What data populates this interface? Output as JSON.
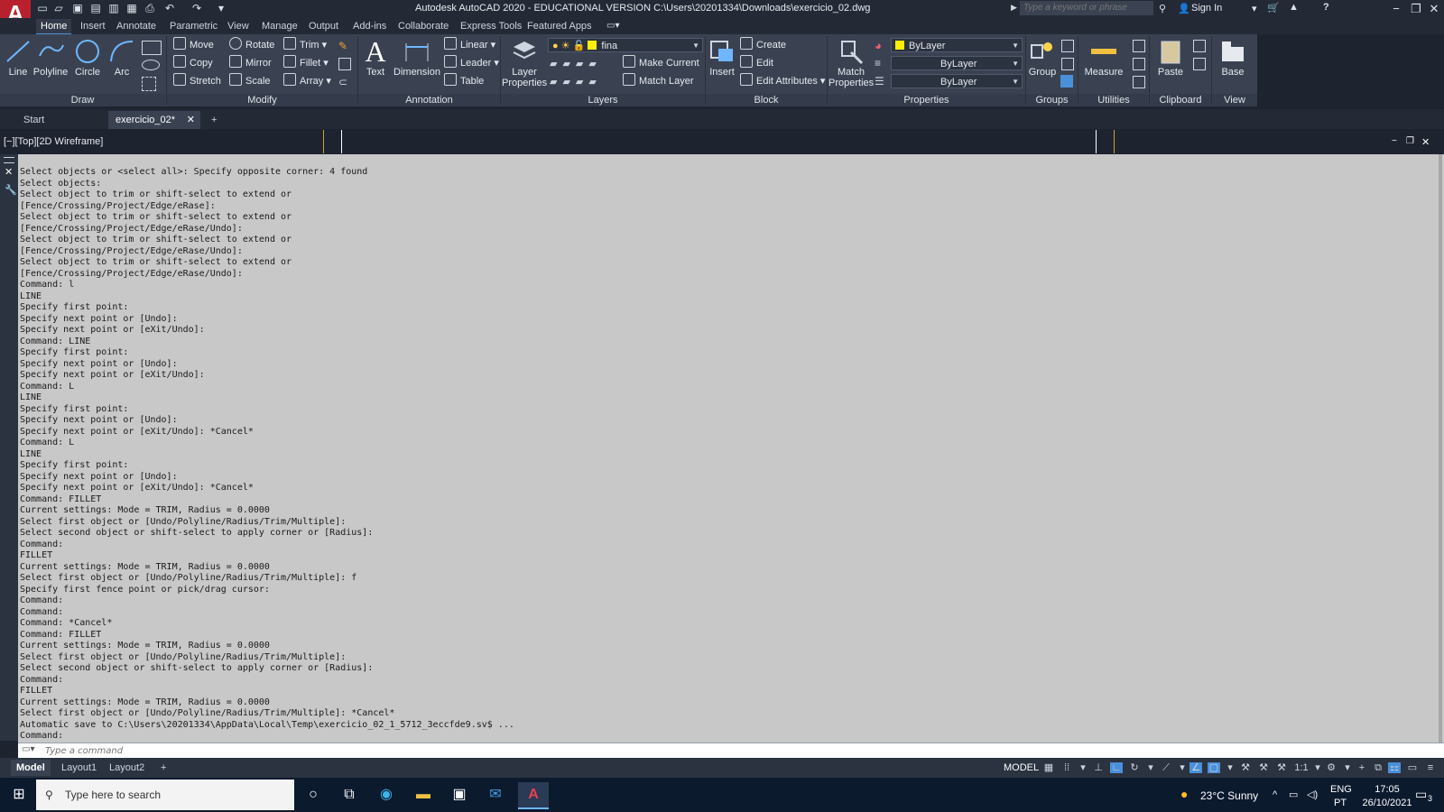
{
  "window": {
    "title": "Autodesk AutoCAD 2020 - EDUCATIONAL VERSION    C:\\Users\\20201334\\Downloads\\exercicio_02.dwg",
    "logo_letter": "A",
    "search_placeholder": "Type a keyword or phrase",
    "sign_in": "Sign In"
  },
  "ribbon_tabs": [
    "Home",
    "Insert",
    "Annotate",
    "Parametric",
    "View",
    "Manage",
    "Output",
    "Add-ins",
    "Collaborate",
    "Express Tools",
    "Featured Apps"
  ],
  "ribbon": {
    "draw": {
      "label": "Draw",
      "line": "Line",
      "polyline": "Polyline",
      "circle": "Circle",
      "arc": "Arc"
    },
    "modify": {
      "label": "Modify",
      "move": "Move",
      "rotate": "Rotate",
      "trim": "Trim",
      "copy": "Copy",
      "mirror": "Mirror",
      "fillet": "Fillet",
      "stretch": "Stretch",
      "scale": "Scale",
      "array": "Array"
    },
    "annotation": {
      "label": "Annotation",
      "text": "Text",
      "dimension": "Dimension",
      "linear": "Linear",
      "leader": "Leader",
      "table": "Table"
    },
    "layers": {
      "label": "Layers",
      "layer_properties_1": "Layer",
      "layer_properties_2": "Properties",
      "current_layer": "fina",
      "make_current": "Make Current",
      "match_layer": "Match Layer"
    },
    "block": {
      "label": "Block",
      "insert": "Insert",
      "create": "Create",
      "edit": "Edit",
      "edit_attributes": "Edit Attributes"
    },
    "properties": {
      "label": "Properties",
      "match_1": "Match",
      "match_2": "Properties",
      "color": "ByLayer",
      "linetype": "ByLayer",
      "lineweight": "ByLayer"
    },
    "groups": {
      "label": "Groups",
      "group": "Group"
    },
    "utilities": {
      "label": "Utilities",
      "measure": "Measure"
    },
    "clipboard": {
      "label": "Clipboard",
      "paste": "Paste"
    },
    "view": {
      "label": "View",
      "base": "Base"
    }
  },
  "file_tabs": {
    "start": "Start",
    "active": "exercicio_02*",
    "add": "+"
  },
  "viewport": {
    "label": "[−][Top][2D Wireframe]"
  },
  "command_history": [
    "Select objects or <select all>: Specify opposite corner: 4 found",
    "Select objects:",
    "Select object to trim or shift-select to extend or",
    "[Fence/Crossing/Project/Edge/eRase]:",
    "Select object to trim or shift-select to extend or",
    "[Fence/Crossing/Project/Edge/eRase/Undo]:",
    "Select object to trim or shift-select to extend or",
    "[Fence/Crossing/Project/Edge/eRase/Undo]:",
    "Select object to trim or shift-select to extend or",
    "[Fence/Crossing/Project/Edge/eRase/Undo]:",
    "Command: l",
    "LINE",
    "Specify first point:",
    "Specify next point or [Undo]:",
    "Specify next point or [eXit/Undo]:",
    "Command: LINE",
    "Specify first point:",
    "Specify next point or [Undo]:",
    "Specify next point or [eXit/Undo]:",
    "Command: L",
    "LINE",
    "Specify first point:",
    "Specify next point or [Undo]:",
    "Specify next point or [eXit/Undo]: *Cancel*",
    "Command: L",
    "LINE",
    "Specify first point:",
    "Specify next point or [Undo]:",
    "Specify next point or [eXit/Undo]: *Cancel*",
    "Command: FILLET",
    "Current settings: Mode = TRIM, Radius = 0.0000",
    "Select first object or [Undo/Polyline/Radius/Trim/Multiple]:",
    "Select second object or shift-select to apply corner or [Radius]:",
    "Command:",
    "FILLET",
    "Current settings: Mode = TRIM, Radius = 0.0000",
    "Select first object or [Undo/Polyline/Radius/Trim/Multiple]: f",
    "Specify first fence point or pick/drag cursor:",
    "Command:",
    "Command:",
    "Command: *Cancel*",
    "Command: FILLET",
    "Current settings: Mode = TRIM, Radius = 0.0000",
    "Select first object or [Undo/Polyline/Radius/Trim/Multiple]:",
    "Select second object or shift-select to apply corner or [Radius]:",
    "Command:",
    "FILLET",
    "Current settings: Mode = TRIM, Radius = 0.0000",
    "Select first object or [Undo/Polyline/Radius/Trim/Multiple]: *Cancel*",
    "Automatic save to C:\\Users\\20201334\\AppData\\Local\\Temp\\exercicio_02_1_5712_3eccfde9.sv$ ...",
    "Command:"
  ],
  "command_input": {
    "placeholder": "Type a command"
  },
  "layout_tabs": [
    "Model",
    "Layout1",
    "Layout2"
  ],
  "status": {
    "model": "MODEL",
    "scale": "1:1"
  },
  "taskbar": {
    "search_placeholder": "Type here to search",
    "weather": "23°C  Sunny",
    "lang_1": "ENG",
    "lang_2": "PT",
    "time": "17:05",
    "date": "26/10/2021",
    "notifications": "3"
  },
  "colors": {
    "accent": "#4a90d9",
    "autocad_red": "#b8202d",
    "layer_yellow": "#ffee00",
    "history_bg": "#c8c8c8"
  }
}
